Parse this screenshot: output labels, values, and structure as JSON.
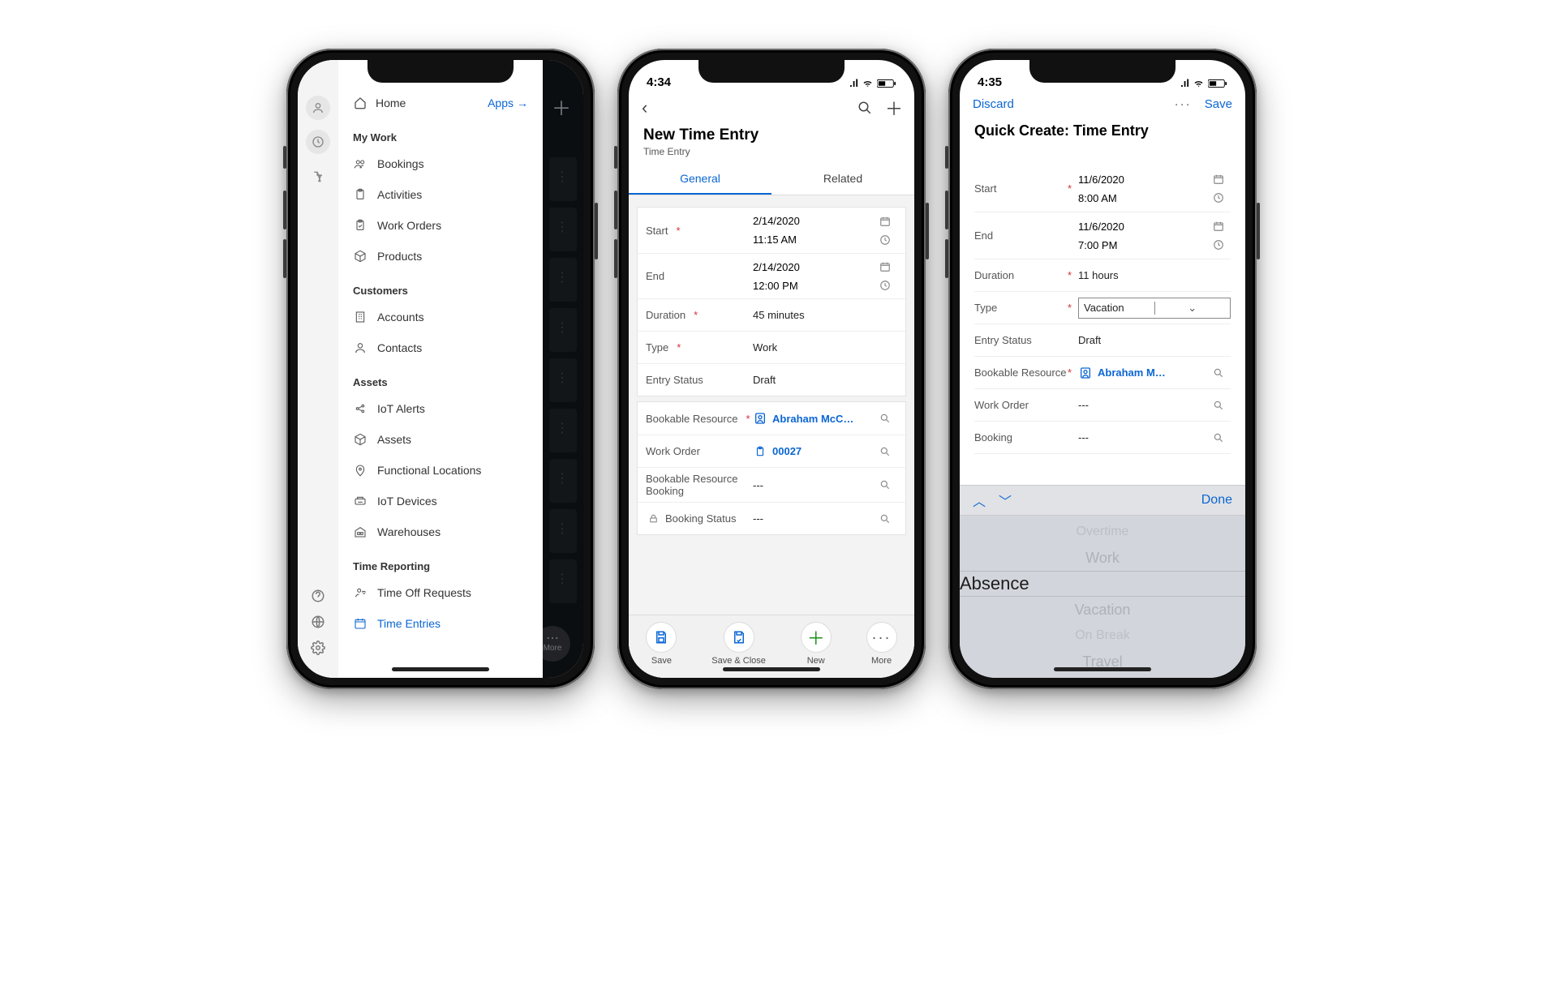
{
  "phone1": {
    "header_icons": {
      "refresh": "refresh-icon",
      "add": "plus-icon"
    },
    "rail": {
      "items": [
        "avatar",
        "clock",
        "pin"
      ],
      "bottom": [
        "help",
        "globe",
        "settings"
      ]
    },
    "home_label": "Home",
    "apps_label": "Apps",
    "sections": [
      {
        "title": "My Work",
        "items": [
          {
            "icon": "people-icon",
            "label": "Bookings"
          },
          {
            "icon": "clipboard-icon",
            "label": "Activities"
          },
          {
            "icon": "clipboard-check-icon",
            "label": "Work Orders"
          },
          {
            "icon": "cube-icon",
            "label": "Products"
          }
        ]
      },
      {
        "title": "Customers",
        "items": [
          {
            "icon": "building-icon",
            "label": "Accounts"
          },
          {
            "icon": "person-icon",
            "label": "Contacts"
          }
        ]
      },
      {
        "title": "Assets",
        "items": [
          {
            "icon": "iot-alert-icon",
            "label": "IoT Alerts"
          },
          {
            "icon": "package-icon",
            "label": "Assets"
          },
          {
            "icon": "location-icon",
            "label": "Functional Locations"
          },
          {
            "icon": "device-icon",
            "label": "IoT Devices"
          },
          {
            "icon": "warehouse-icon",
            "label": "Warehouses"
          }
        ]
      },
      {
        "title": "Time Reporting",
        "items": [
          {
            "icon": "timeoff-icon",
            "label": "Time Off Requests"
          },
          {
            "icon": "calendar-icon",
            "label": "Time Entries",
            "active": true
          }
        ]
      }
    ],
    "more_label": "More"
  },
  "phone2": {
    "status_time": "4:34",
    "title": "New Time Entry",
    "subtitle": "Time Entry",
    "tabs": [
      {
        "label": "General",
        "active": true
      },
      {
        "label": "Related",
        "active": false
      }
    ],
    "card1": [
      {
        "label": "Start",
        "required": true,
        "lines": [
          {
            "text": "2/14/2020",
            "icon": "calendar"
          },
          {
            "text": "11:15 AM",
            "icon": "clock"
          }
        ]
      },
      {
        "label": "End",
        "lines": [
          {
            "text": "2/14/2020",
            "icon": "calendar"
          },
          {
            "text": "12:00 PM",
            "icon": "clock"
          }
        ]
      },
      {
        "label": "Duration",
        "required": true,
        "value": "45 minutes"
      },
      {
        "label": "Type",
        "required": true,
        "value": "Work"
      },
      {
        "label": "Entry Status",
        "value": "Draft"
      }
    ],
    "card2": [
      {
        "label": "Bookable Resource",
        "required": true,
        "link": true,
        "icon": "person-badge",
        "value": "Abraham McC…",
        "lookup": true
      },
      {
        "label": "Work Order",
        "link": true,
        "icon": "clipboard",
        "value": "00027",
        "lookup": true
      },
      {
        "label": "Bookable Resource Booking",
        "value": "---",
        "lookup": true
      },
      {
        "label": "Booking Status",
        "locked": true,
        "value": "---",
        "lookup": true
      }
    ],
    "footer": [
      {
        "icon": "save",
        "label": "Save"
      },
      {
        "icon": "save-close",
        "label": "Save & Close"
      },
      {
        "icon": "plus",
        "label": "New",
        "style": "new"
      },
      {
        "icon": "dots",
        "label": "More"
      }
    ]
  },
  "phone3": {
    "status_time": "4:35",
    "discard_label": "Discard",
    "save_label": "Save",
    "title": "Quick Create: Time Entry",
    "rows": [
      {
        "label": "Start",
        "required": true,
        "lines": [
          {
            "text": "11/6/2020",
            "icon": "calendar"
          },
          {
            "text": "8:00 AM",
            "icon": "clock"
          }
        ]
      },
      {
        "label": "End",
        "lines": [
          {
            "text": "11/6/2020",
            "icon": "calendar"
          },
          {
            "text": "7:00 PM",
            "icon": "clock"
          }
        ]
      },
      {
        "label": "Duration",
        "required": true,
        "value": "11 hours"
      },
      {
        "label": "Type",
        "required": true,
        "select": "Vacation"
      },
      {
        "label": "Entry Status",
        "value": "Draft"
      },
      {
        "label": "Bookable Resource",
        "required": true,
        "link": true,
        "icon": "person-badge",
        "value": "Abraham M…",
        "lookup": true
      },
      {
        "label": "Work Order",
        "value": "---",
        "lookup": true
      },
      {
        "label": "Booking",
        "value": "---",
        "lookup": true
      }
    ],
    "acc_done": "Done",
    "picker": {
      "options": [
        "Overtime",
        "Work",
        "Absence",
        "Vacation",
        "On Break",
        "Travel"
      ],
      "selected": "Absence"
    }
  }
}
